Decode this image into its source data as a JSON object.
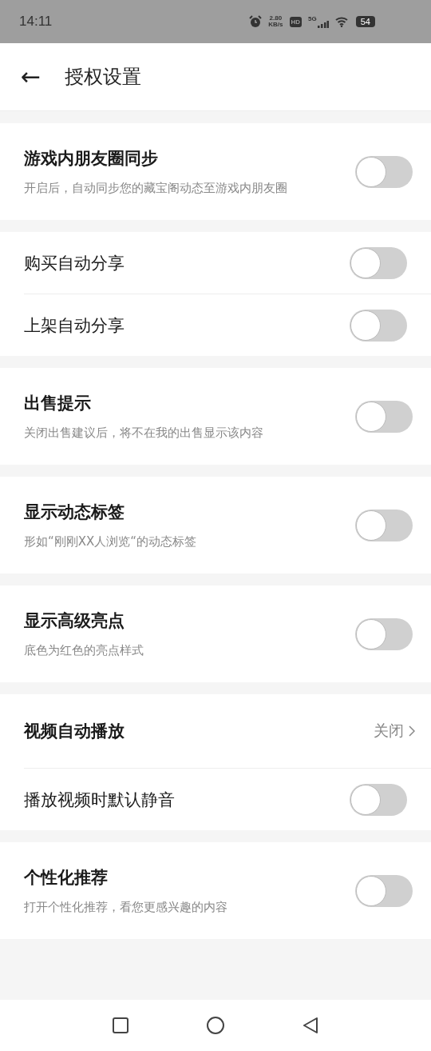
{
  "status_bar": {
    "time": "14:11",
    "speed": "2.80",
    "speed_unit": "KB/s",
    "hd": "HD",
    "network": "5G",
    "battery": "54"
  },
  "header": {
    "back": "←",
    "title": "授权设置"
  },
  "sections": [
    {
      "rows": [
        {
          "kind": "switch",
          "primary": true,
          "title": "游戏内朋友圈同步",
          "description": "开启后，自动同步您的藏宝阁动态至游戏内朋友圈",
          "on": false
        }
      ]
    },
    {
      "rows": [
        {
          "kind": "switch",
          "primary": false,
          "title": "购买自动分享",
          "on": false
        },
        {
          "kind": "switch",
          "primary": false,
          "title": "上架自动分享",
          "on": false
        }
      ]
    },
    {
      "rows": [
        {
          "kind": "switch",
          "primary": true,
          "title": "出售提示",
          "description": "关闭出售建议后，将不在我的出售显示该内容",
          "on": false
        }
      ]
    },
    {
      "rows": [
        {
          "kind": "switch",
          "primary": true,
          "title": "显示动态标签",
          "description": "形如“刚刚XX人浏览“的动态标签",
          "on": false
        }
      ]
    },
    {
      "rows": [
        {
          "kind": "switch",
          "primary": true,
          "title": "显示高级亮点",
          "description": "底色为红色的亮点样式",
          "on": false
        }
      ]
    },
    {
      "rows": [
        {
          "kind": "link",
          "primary": true,
          "title": "视频自动播放",
          "value": "关闭"
        },
        {
          "kind": "switch",
          "primary": false,
          "title": "播放视频时默认静音",
          "on": false
        }
      ]
    },
    {
      "rows": [
        {
          "kind": "switch",
          "primary": true,
          "title": "个性化推荐",
          "description": "打开个性化推荐，看您更感兴趣的内容",
          "on": false
        }
      ]
    }
  ]
}
